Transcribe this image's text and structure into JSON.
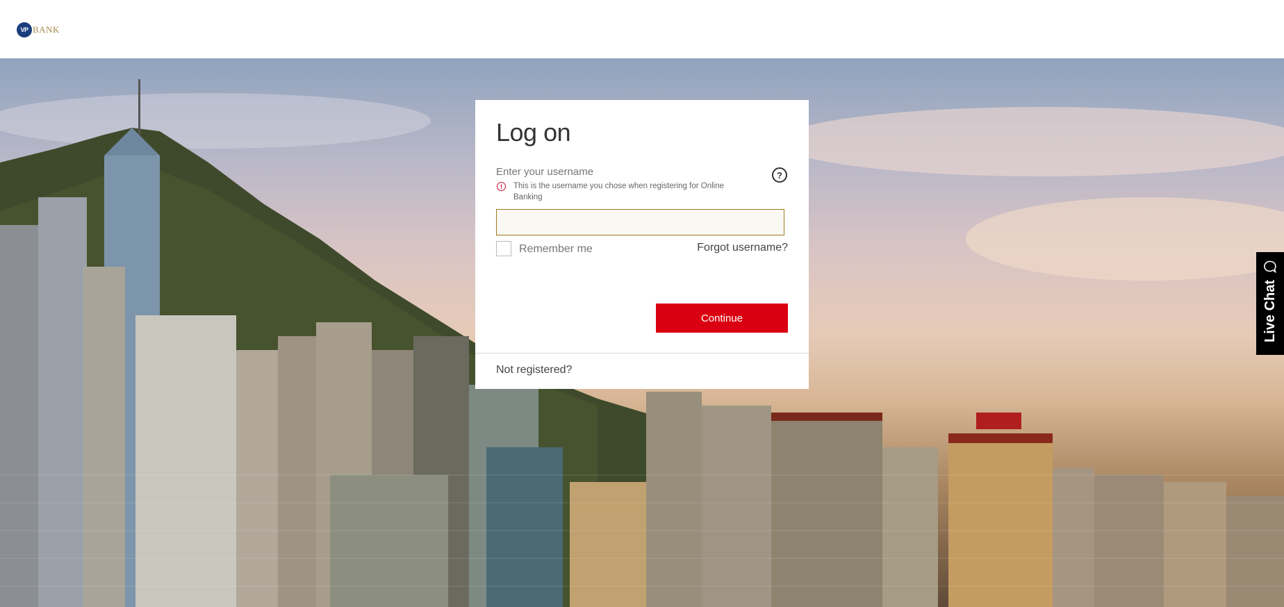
{
  "header": {
    "logo_mark": "VP",
    "logo_text": "BANK"
  },
  "login": {
    "title": "Log on",
    "username_label": "Enter your username",
    "username_hint": "This is the username you chose when registering for Online Banking",
    "username_value": "",
    "remember_label": "Remember me",
    "remember_checked": false,
    "forgot_label": "Forgot username?",
    "continue_label": "Continue",
    "not_registered_label": "Not registered?",
    "help_icon": "question-circle-icon",
    "error_icon": "exclamation-circle-icon"
  },
  "live_chat": {
    "label": "Live Chat",
    "icon": "chat-bubble-icon"
  },
  "colors": {
    "brand_red": "#db0011",
    "input_border": "#9e7a1a",
    "logo_blue": "#1a3d7c",
    "logo_gold": "#a88a4a"
  }
}
